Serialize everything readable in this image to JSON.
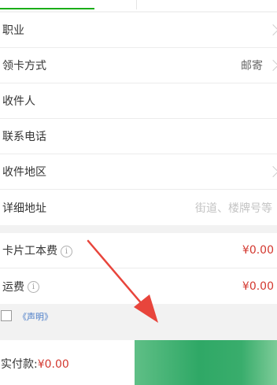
{
  "form": {
    "occupation_label": "职业",
    "delivery_label": "领卡方式",
    "delivery_value": "邮寄",
    "recipient_label": "收件人",
    "phone_label": "联系电话",
    "region_label": "收件地区",
    "address_label": "详细地址",
    "address_placeholder": "街道、楼牌号等"
  },
  "fees": {
    "card_fee_label": "卡片工本费",
    "card_fee_value": "¥0.00",
    "shipping_label": "运费",
    "shipping_value": "¥0.00"
  },
  "agreement": {
    "link_text": "《声明》"
  },
  "footer": {
    "total_label": "实付款:",
    "total_amount": "¥0.00",
    "pay_button_label": ""
  },
  "colors": {
    "accent_green": "#1aad19",
    "price_red": "#d3382f",
    "annotation_arrow": "#e8453c"
  },
  "icons": {
    "info": "info-circle-icon",
    "chevron": "chevron-right-icon",
    "arrow": "annotation-arrow"
  }
}
